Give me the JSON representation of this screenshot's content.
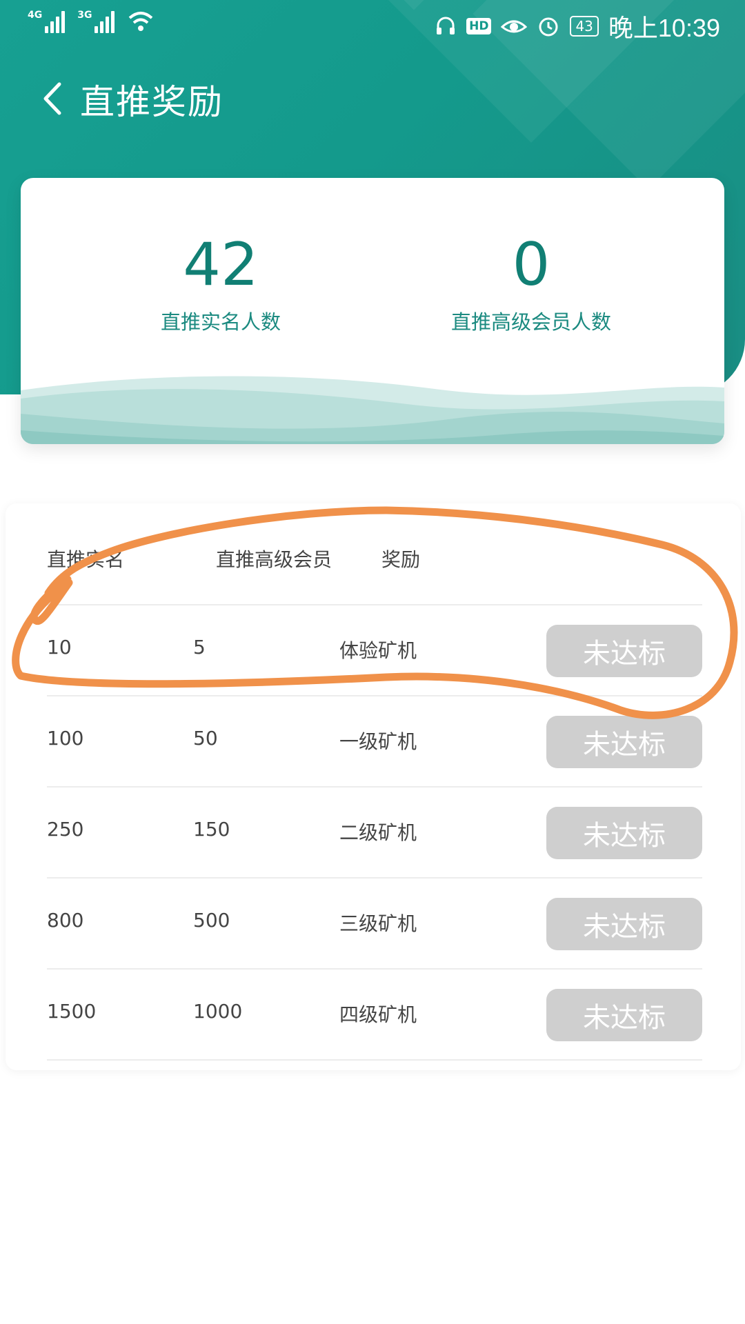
{
  "status_bar": {
    "net1": "4G",
    "net2": "3G",
    "battery": "43",
    "time": "晚上10:39",
    "hd": "HD"
  },
  "nav": {
    "title": "直推奖励"
  },
  "stats": [
    {
      "value": "42",
      "label": "直推实名人数"
    },
    {
      "value": "0",
      "label": "直推高级会员人数"
    }
  ],
  "table": {
    "headers": [
      "直推实名",
      "直推高级会员",
      "奖励"
    ],
    "rows": [
      {
        "real": "10",
        "senior": "5",
        "reward": "体验矿机",
        "status": "未达标"
      },
      {
        "real": "100",
        "senior": "50",
        "reward": "一级矿机",
        "status": "未达标"
      },
      {
        "real": "250",
        "senior": "150",
        "reward": "二级矿机",
        "status": "未达标"
      },
      {
        "real": "800",
        "senior": "500",
        "reward": "三级矿机",
        "status": "未达标"
      },
      {
        "real": "1500",
        "senior": "1000",
        "reward": "四级矿机",
        "status": "未达标"
      }
    ]
  },
  "colors": {
    "header": "#149a8c",
    "stat_text": "#117f74",
    "button_disabled": "#cfcfcf",
    "annotation": "#f0914a"
  }
}
